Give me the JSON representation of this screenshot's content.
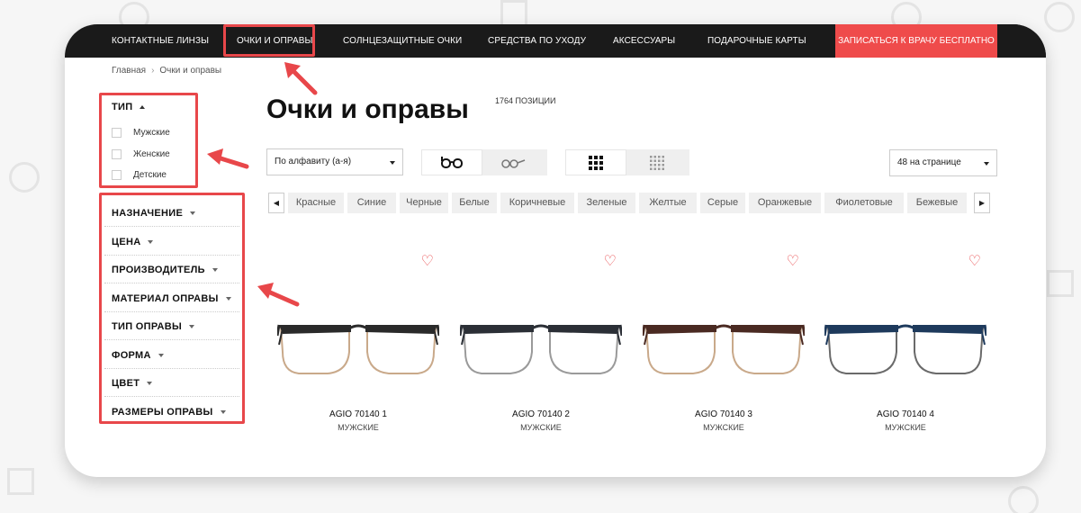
{
  "nav": {
    "items": [
      "КОНТАКТНЫЕ ЛИНЗЫ",
      "ОЧКИ И ОПРАВЫ",
      "СОЛНЦЕЗАЩИТНЫЕ ОЧКИ",
      "СРЕДСТВА ПО УХОДУ",
      "АКСЕССУАРЫ",
      "ПОДАРОЧНЫЕ КАРТЫ"
    ],
    "cta": "ЗАПИСАТЬСЯ К ВРАЧУ БЕСПЛАТНО"
  },
  "breadcrumb": {
    "home": "Главная",
    "sep": "›",
    "current": "Очки и оправы"
  },
  "filters": {
    "type_title": "ТИП",
    "type_options": [
      "Мужские",
      "Женские",
      "Детские"
    ],
    "groups": [
      "НАЗНАЧЕНИЕ",
      "ЦЕНА",
      "ПРОИЗВОДИТЕЛЬ",
      "МАТЕРИАЛ ОПРАВЫ",
      "ТИП ОПРАВЫ",
      "ФОРМА",
      "ЦВЕТ",
      "РАЗМЕРЫ ОПРАВЫ"
    ]
  },
  "page": {
    "title": "Очки и оправы",
    "count": "1764 ПОЗИЦИИ"
  },
  "toolbar": {
    "sort_value": "По алфавиту (а-я)",
    "per_page_value": "48 на странице"
  },
  "colors_filter": [
    "Красные",
    "Синие",
    "Черные",
    "Белые",
    "Коричневые",
    "Зеленые",
    "Желтые",
    "Серые",
    "Оранжевые",
    "Фиолетовые",
    "Бежевые"
  ],
  "products": [
    {
      "name": "AGIO 70140 1",
      "type": "МУЖСКИЕ",
      "frame_color": "#2a2a2a",
      "lower_color": "#c9a98a"
    },
    {
      "name": "AGIO 70140 2",
      "type": "МУЖСКИЕ",
      "frame_color": "#2b2f36",
      "lower_color": "#9a9a9a"
    },
    {
      "name": "AGIO 70140 3",
      "type": "МУЖСКИЕ",
      "frame_color": "#4a2a22",
      "lower_color": "#c9a98a"
    },
    {
      "name": "AGIO 70140 4",
      "type": "МУЖСКИЕ",
      "frame_color": "#1e3a5c",
      "lower_color": "#6a6a6a"
    }
  ],
  "theme": {
    "accent": "#e8474a",
    "cta_bg": "#ef4b4b",
    "nav_bg": "#1a1a1a"
  }
}
